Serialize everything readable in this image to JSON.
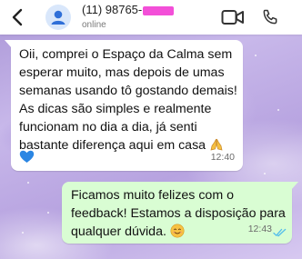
{
  "header": {
    "contact_name": "(11) 98765-",
    "status": "online"
  },
  "messages": {
    "incoming": {
      "text": "Oii, comprei o Espaço da Calma sem esperar muito, mas depois de umas semanas usando tô gostando demais! As dicas são simples e realmente funcionam no dia a dia, já senti bastante diferença aqui em casa",
      "emoji_name": "folded-hands-emoji",
      "heart_name": "blue-heart-emoji",
      "time": "12:40"
    },
    "outgoing": {
      "text": "Ficamos muito felizes com o feedback! Estamos a disposição para qualquer dúvida.",
      "emoji_name": "smiling-face-emoji",
      "time": "12:43",
      "status_icon": "double-check-read-icon"
    }
  },
  "colors": {
    "header_bg": "#ffffff",
    "incoming_bg": "#ffffff",
    "outgoing_bg": "#d9fdd3",
    "read_ticks": "#53bdeb",
    "redaction": "#f34fd8"
  }
}
